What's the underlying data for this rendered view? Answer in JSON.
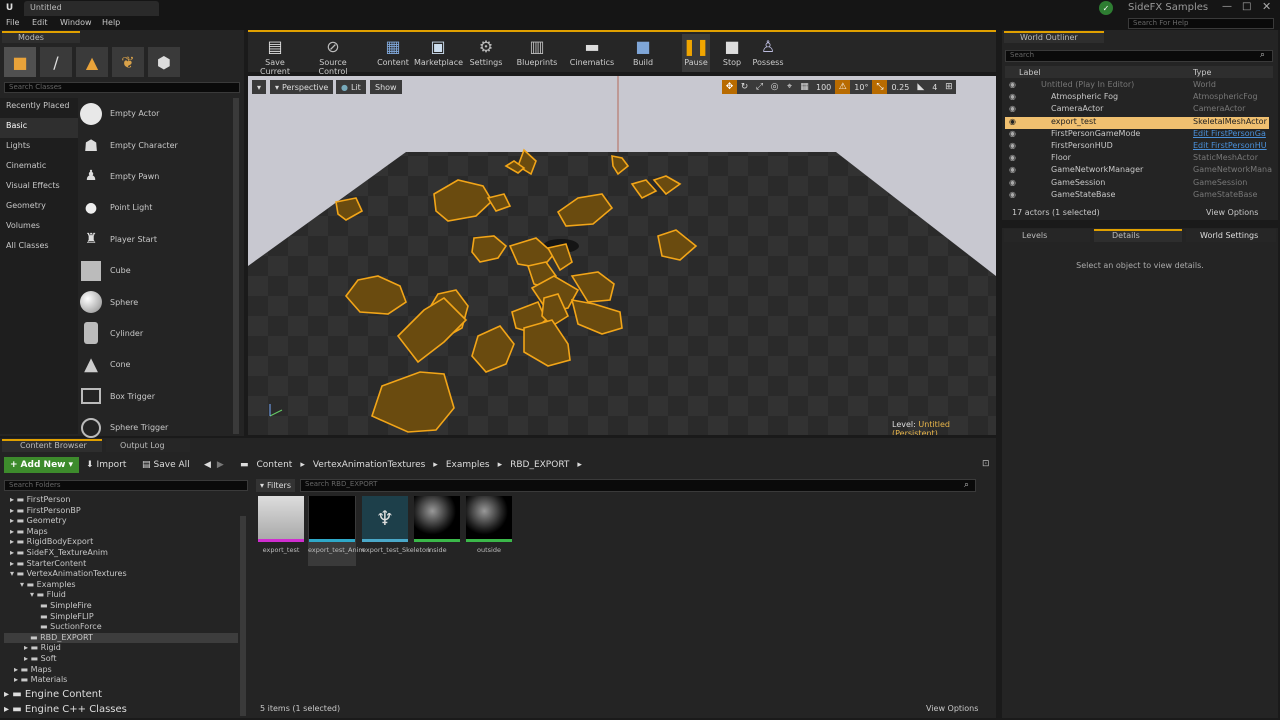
{
  "window": {
    "tab_title": "Untitled",
    "project": "SideFX Samples",
    "help_placeholder": "Search For Help"
  },
  "menu": [
    "File",
    "Edit",
    "Window",
    "Help"
  ],
  "modes": {
    "tab": "Modes",
    "search_placeholder": "Search Classes",
    "categories": [
      "Recently Placed",
      "Basic",
      "Lights",
      "Cinematic",
      "Visual Effects",
      "Geometry",
      "Volumes",
      "All Classes"
    ],
    "selected": "Basic",
    "items": [
      "Empty Actor",
      "Empty Character",
      "Empty Pawn",
      "Point Light",
      "Player Start",
      "Cube",
      "Sphere",
      "Cylinder",
      "Cone",
      "Box Trigger",
      "Sphere Trigger"
    ]
  },
  "toolbar": [
    "Save Current",
    "Source Control",
    "Content",
    "Marketplace",
    "Settings",
    "Blueprints",
    "Cinematics",
    "Build",
    "Pause",
    "Stop",
    "Possess"
  ],
  "viewport": {
    "perspective": "Perspective",
    "lit": "Lit",
    "show": "Show",
    "fov": "100",
    "angle": "10°",
    "scale": "0.25",
    "cam": "4",
    "level_label": "Level:",
    "level_name": "Untitled (Persistent)"
  },
  "outliner": {
    "tab": "World Outliner",
    "search_placeholder": "Search",
    "col_label": "Label",
    "col_type": "Type",
    "rows": [
      {
        "label": "Untitled (Play In Editor)",
        "type": "World"
      },
      {
        "label": "Atmospheric Fog",
        "type": "AtmosphericFog"
      },
      {
        "label": "CameraActor",
        "type": "CameraActor"
      },
      {
        "label": "export_test",
        "type": "SkeletalMeshActor"
      },
      {
        "label": "FirstPersonGameMode",
        "type": "Edit FirstPersonGa"
      },
      {
        "label": "FirstPersonHUD",
        "type": "Edit FirstPersonHU"
      },
      {
        "label": "Floor",
        "type": "StaticMeshActor"
      },
      {
        "label": "GameNetworkManager",
        "type": "GameNetworkMana"
      },
      {
        "label": "GameSession",
        "type": "GameSession"
      },
      {
        "label": "GameStateBase",
        "type": "GameStateBase"
      }
    ],
    "count": "17 actors (1 selected)",
    "view_options": "View Options"
  },
  "details": {
    "tabs": [
      "Levels",
      "Details",
      "World Settings"
    ],
    "empty": "Select an object to view details."
  },
  "content": {
    "tabs": [
      "Content Browser",
      "Output Log"
    ],
    "add_new": "Add New",
    "import": "Import",
    "save_all": "Save All",
    "path": [
      "Content",
      "VertexAnimationTextures",
      "Examples",
      "RBD_EXPORT"
    ],
    "folder_search": "Search Folders",
    "filters": "Filters",
    "asset_search": "Search RBD_EXPORT",
    "folders": [
      "FirstPerson",
      "FirstPersonBP",
      "Geometry",
      "Maps",
      "RigidBodyExport",
      "SideFX_TextureAnim",
      "StarterContent",
      "VertexAnimationTextures",
      "Examples",
      "Fluid",
      "SimpleFire",
      "SimpleFLIP",
      "SuctionForce",
      "RBD_EXPORT",
      "Rigid",
      "Soft",
      "Maps",
      "Materials"
    ],
    "engine": [
      "Engine Content",
      "Engine C++ Classes"
    ],
    "assets": [
      "export_test",
      "export_test_Anim",
      "export_test_Skeleton",
      "inside",
      "outside"
    ],
    "status": "5 items (1 selected)",
    "view_options": "View Options"
  }
}
